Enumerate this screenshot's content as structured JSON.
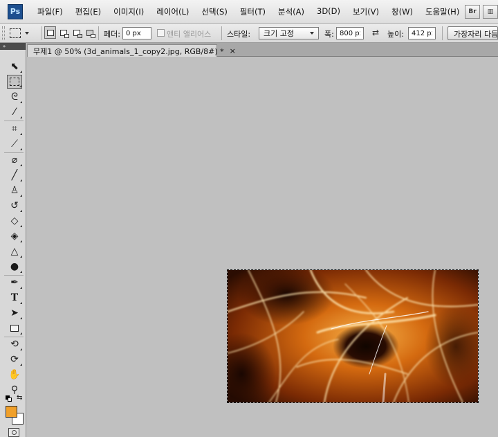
{
  "app": {
    "logo": "Ps"
  },
  "menu": [
    "파일(F)",
    "편집(E)",
    "이미지(I)",
    "레이어(L)",
    "선택(S)",
    "필터(T)",
    "분석(A)",
    "3D(D)",
    "보기(V)",
    "창(W)",
    "도움말(H)"
  ],
  "menu_right": {
    "bridge_label": "Br",
    "view_label": "▥"
  },
  "options": {
    "feather_label": "페더:",
    "feather_value": "0 px",
    "antialias_label": "앤티 앨리어스",
    "style_label": "스타일:",
    "style_value": "크기 고정",
    "width_label": "폭:",
    "width_value": "800 px",
    "swap_symbol": "⇄",
    "height_label": "높이:",
    "height_value": "412 px",
    "refine_edge_label": "가장자리 다듬기..."
  },
  "toolpanel": {
    "collapse_label": "»"
  },
  "document": {
    "tab_title": "무제1 @ 50% (3d_animals_1_copy2.jpg, RGB/8#) *",
    "close_symbol": "×"
  },
  "colors": {
    "foreground": "#f0a02a",
    "background": "#ffffff"
  },
  "tools": [
    {
      "name": "move-tool",
      "icon": "move-icon"
    },
    {
      "name": "rectangular-marquee-tool",
      "icon": "marquee-icon"
    },
    {
      "name": "lasso-tool",
      "icon": "lasso-icon"
    },
    {
      "name": "magic-wand-tool",
      "icon": "magic-wand-icon"
    },
    {
      "name": "crop-tool",
      "icon": "crop-icon"
    },
    {
      "name": "eyedropper-tool",
      "icon": "eyedropper-icon"
    },
    {
      "name": "healing-brush-tool",
      "icon": "bandage-icon"
    },
    {
      "name": "brush-tool",
      "icon": "brush-icon"
    },
    {
      "name": "clone-stamp-tool",
      "icon": "stamp-icon"
    },
    {
      "name": "history-brush-tool",
      "icon": "history-brush-icon"
    },
    {
      "name": "eraser-tool",
      "icon": "eraser-icon"
    },
    {
      "name": "paint-bucket-tool",
      "icon": "bucket-icon"
    },
    {
      "name": "blur-tool",
      "icon": "blur-icon"
    },
    {
      "name": "dodge-tool",
      "icon": "dodge-icon"
    },
    {
      "name": "pen-tool",
      "icon": "pen-icon"
    },
    {
      "name": "type-tool",
      "icon": "type-icon"
    },
    {
      "name": "path-selection-tool",
      "icon": "arrow-icon"
    },
    {
      "name": "shape-tool",
      "icon": "rectangle-icon"
    },
    {
      "name": "3d-rotate-tool",
      "icon": "3d-rotate-icon"
    },
    {
      "name": "3d-orbit-tool",
      "icon": "3d-orbit-icon"
    },
    {
      "name": "hand-tool",
      "icon": "hand-icon"
    },
    {
      "name": "zoom-tool",
      "icon": "zoom-icon"
    }
  ]
}
